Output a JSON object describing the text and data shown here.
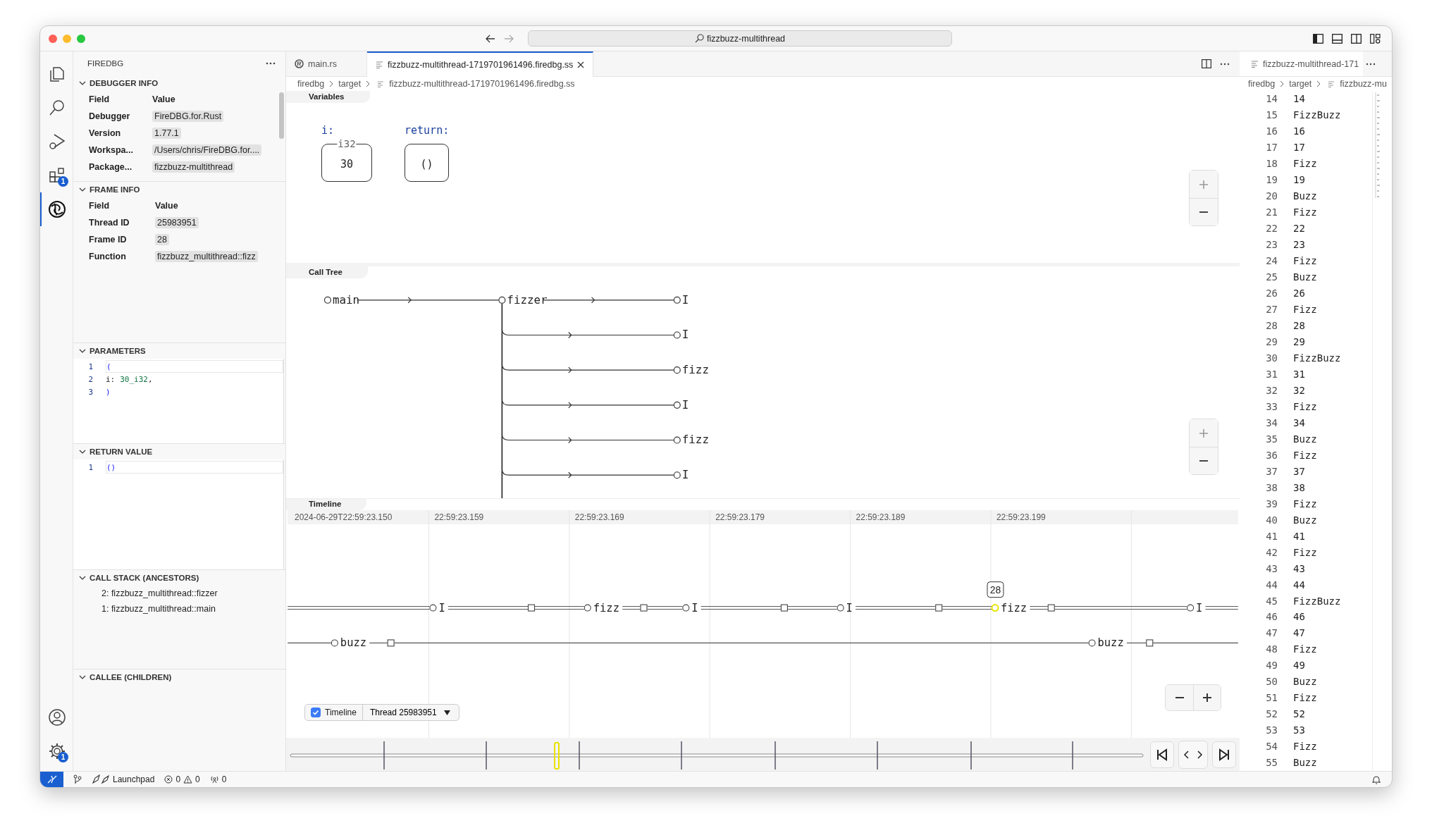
{
  "title_bar": {
    "search": "fizzbuzz-multithread"
  },
  "activity_bar": {
    "items": [
      {
        "kind": "files",
        "selected": false
      },
      {
        "kind": "search",
        "selected": false
      },
      {
        "kind": "debug",
        "selected": false
      },
      {
        "kind": "extensions",
        "selected": false,
        "badge": "1"
      },
      {
        "kind": "firedbg",
        "selected": true
      }
    ],
    "bottom": [
      {
        "kind": "account"
      },
      {
        "kind": "settings",
        "badge": "1"
      }
    ]
  },
  "sidebar": {
    "title": "FIREDBG",
    "sections": [
      {
        "kind": "table",
        "title": "DEBUGGER INFO",
        "expanded": true,
        "columns": [
          "Field",
          "Value"
        ],
        "rows": [
          {
            "field": "Debugger",
            "value": "FireDBG.for.Rust"
          },
          {
            "field": "Version",
            "value": "1.77.1"
          },
          {
            "field": "Workspa...",
            "value": "/Users/chris/FireDBG.for...."
          },
          {
            "field": "Package...",
            "value": "fizzbuzz-multithread"
          }
        ]
      },
      {
        "kind": "table",
        "title": "FRAME INFO",
        "expanded": true,
        "columns": [
          "Field",
          "Value"
        ],
        "rows": [
          {
            "field": "Thread ID",
            "value": "25983951"
          },
          {
            "field": "Frame ID",
            "value": "28"
          },
          {
            "field": "Function",
            "value": "fizzbuzz_multithread::fizz"
          }
        ]
      },
      {
        "kind": "code",
        "title": "PARAMETERS",
        "expanded": true,
        "lines": [
          {
            "number": "1",
            "tokens": [
              {
                "kind": "paren",
                "text": "("
              }
            ]
          },
          {
            "number": "2",
            "tokens": [
              {
                "kind": "plain",
                "text": "i:"
              },
              {
                "kind": "number",
                "text": "30_i32"
              },
              {
                "kind": "plain",
                "text": ","
              }
            ]
          },
          {
            "number": "3",
            "tokens": [
              {
                "kind": "paren",
                "text": ")"
              }
            ]
          }
        ]
      },
      {
        "kind": "code",
        "title": "RETURN VALUE",
        "expanded": true,
        "lines": [
          {
            "number": "1",
            "tokens": [
              {
                "kind": "paren",
                "text": "()"
              }
            ]
          }
        ]
      },
      {
        "kind": "list",
        "title": "CALL STACK (ANCESTORS)",
        "expanded": true,
        "items": [
          "2: fizzbuzz_multithread::fizzer",
          "1: fizzbuzz_multithread::main"
        ]
      },
      {
        "kind": "list",
        "title": "CALLEE (CHILDREN)",
        "expanded": true
      }
    ]
  },
  "editor": {
    "tabs": [
      {
        "kind": "rust",
        "label": "main.rs",
        "selected": false
      },
      {
        "kind": "file",
        "label": "fizzbuzz-multithread-1719701961496.firedbg.ss",
        "selected": true
      }
    ],
    "breadcrumb": [
      "firedbg",
      "target",
      "fizzbuzz-multithread-1719701961496.firedbg.ss"
    ],
    "variables": {
      "title": "Variables",
      "items": [
        {
          "name": "i:",
          "type": "i32",
          "value": "30"
        },
        {
          "name": "return:",
          "value": "()"
        }
      ]
    },
    "call_tree": {
      "title": "Call Tree",
      "root": {
        "label": "main",
        "children": [
          {
            "label": "fizzer",
            "children": [
              {
                "label": "I"
              },
              {
                "label": "I"
              },
              {
                "label": "fizz"
              },
              {
                "label": "I"
              },
              {
                "label": "fizz"
              },
              {
                "label": "I"
              }
            ]
          }
        ]
      }
    },
    "timeline": {
      "title": "Timeline",
      "ticks": [
        "2024-06-29T22:59:23.150",
        "22:59:23.159",
        "22:59:23.169",
        "22:59:23.179",
        "22:59:23.189",
        "22:59:23.199"
      ],
      "tracks": [
        {
          "kind": "double",
          "events": [
            {
              "label": "I",
              "selected": false
            },
            {
              "label": "fizz",
              "selected": false
            },
            {
              "label": "I",
              "selected": false
            },
            {
              "label": "I",
              "selected": false
            },
            {
              "label": "fizz",
              "selected": true,
              "badge": "28"
            },
            {
              "label": "I",
              "selected": false
            }
          ]
        },
        {
          "kind": "single",
          "events": [
            {
              "label": "buzz",
              "selected": false
            },
            {
              "label": "buzz",
              "selected": false
            }
          ]
        }
      ],
      "toggle": {
        "label": "Timeline",
        "checked": true
      },
      "thread_select": "Thread 25983951"
    }
  },
  "right_editor": {
    "tab": "fizzbuzz-multithread-171",
    "breadcrumb": [
      "firedbg",
      "target",
      "fizzbuzz-mu"
    ],
    "lines": [
      {
        "number": "14",
        "text": "14"
      },
      {
        "number": "15",
        "text": "FizzBuzz"
      },
      {
        "number": "16",
        "text": "16"
      },
      {
        "number": "17",
        "text": "17"
      },
      {
        "number": "18",
        "text": "Fizz"
      },
      {
        "number": "19",
        "text": "19"
      },
      {
        "number": "20",
        "text": "Buzz"
      },
      {
        "number": "21",
        "text": "Fizz"
      },
      {
        "number": "22",
        "text": "22"
      },
      {
        "number": "23",
        "text": "23"
      },
      {
        "number": "24",
        "text": "Fizz"
      },
      {
        "number": "25",
        "text": "Buzz"
      },
      {
        "number": "26",
        "text": "26"
      },
      {
        "number": "27",
        "text": "Fizz"
      },
      {
        "number": "28",
        "text": "28"
      },
      {
        "number": "29",
        "text": "29"
      },
      {
        "number": "30",
        "text": "FizzBuzz"
      },
      {
        "number": "31",
        "text": "31"
      },
      {
        "number": "32",
        "text": "32"
      },
      {
        "number": "33",
        "text": "Fizz"
      },
      {
        "number": "34",
        "text": "34"
      },
      {
        "number": "35",
        "text": "Buzz"
      },
      {
        "number": "36",
        "text": "Fizz"
      },
      {
        "number": "37",
        "text": "37"
      },
      {
        "number": "38",
        "text": "38"
      },
      {
        "number": "39",
        "text": "Fizz"
      },
      {
        "number": "40",
        "text": "Buzz"
      },
      {
        "number": "41",
        "text": "41"
      },
      {
        "number": "42",
        "text": "Fizz"
      },
      {
        "number": "43",
        "text": "43"
      },
      {
        "number": "44",
        "text": "44"
      },
      {
        "number": "45",
        "text": "FizzBuzz"
      },
      {
        "number": "46",
        "text": "46"
      },
      {
        "number": "47",
        "text": "47"
      },
      {
        "number": "48",
        "text": "Fizz"
      },
      {
        "number": "49",
        "text": "49"
      },
      {
        "number": "50",
        "text": "Buzz"
      },
      {
        "number": "51",
        "text": "Fizz"
      },
      {
        "number": "52",
        "text": "52"
      },
      {
        "number": "53",
        "text": "53"
      },
      {
        "number": "54",
        "text": "Fizz"
      },
      {
        "number": "55",
        "text": "Buzz"
      }
    ]
  },
  "status_bar": {
    "launchpad": "Launchpad",
    "errors": "0",
    "warnings": "0",
    "ports": "0"
  }
}
